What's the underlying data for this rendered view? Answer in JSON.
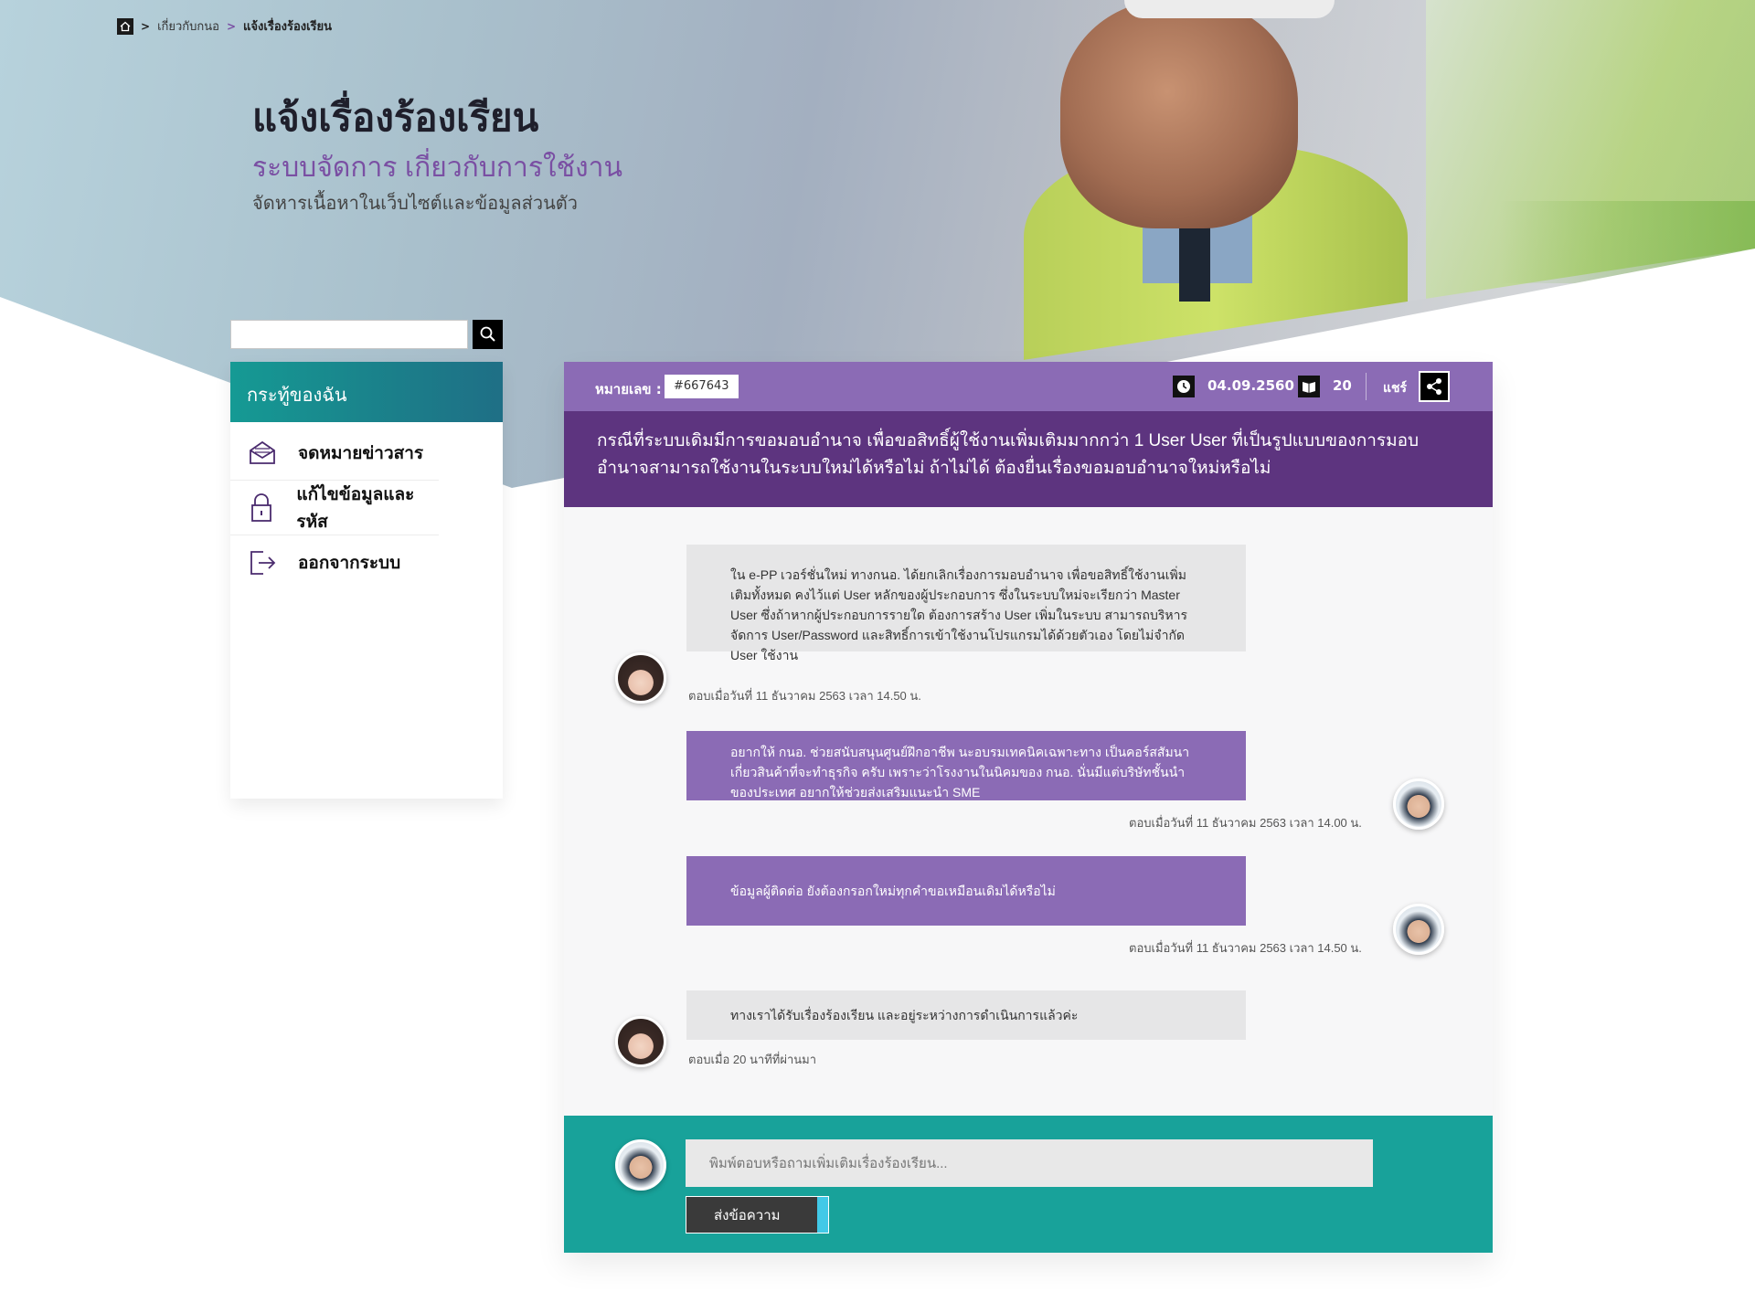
{
  "breadcrumb": {
    "items": [
      "เกี่ยวกับกนอ",
      "แจ้งเรื่องร้องเรียน"
    ]
  },
  "header": {
    "title": "แจ้งเรื่องร้องเรียน",
    "subtitle": "ระบบจัดการ เกี่ยวกับการใช้งาน",
    "description": "จัดหารเนื้อหาในเว็บไซต์และข้อมูลส่วนตัว"
  },
  "search": {
    "value": ""
  },
  "sidebar": {
    "title": "กระทู้ของฉัน",
    "items": [
      {
        "label": "จดหมายข่าวสาร",
        "icon": "mail-open-icon"
      },
      {
        "label": "แก้ไขข้อมูลและรหัส",
        "icon": "lock-icon"
      },
      {
        "label": "ออกจากระบบ",
        "icon": "logout-icon"
      }
    ]
  },
  "ticket": {
    "number_label": "หมายเลข :",
    "number": "#667643",
    "date": "04.09.2560",
    "reads": "20",
    "share_label": "แชร์",
    "question": "กรณีที่ระบบเดิมมีการขอมอบอำนาจ เพื่อขอสิทธิ์ผู้ใช้งานเพิ่มเติมมากกว่า 1 User User ที่เป็นรูปแบบของการมอบอำนาจสามารถใช้งานในระบบใหม่ได้หรือไม่ ถ้าไม่ได้ ต้องยื่นเรื่องขอมอบอำนาจใหม่หรือไม่"
  },
  "messages": [
    {
      "side": "left",
      "text": "ใน e-PP เวอร์ชั่นใหม่ ทางกนอ. ได้ยกเลิกเรื่องการมอบอำนาจ เพื่อขอสิทธิ์ใช้งานเพิ่มเติมทั้งหมด คงไว้แต่ User หลักของผู้ประกอบการ ซึ่งในระบบใหม่จะเรียกว่า Master User ซึ่งถ้าหากผู้ประกอบการรายใด ต้องการสร้าง User เพิ่มในระบบ สามารถบริหารจัดการ User/Password และสิทธิ์การเข้าใช้งานโปรแกรมได้ด้วยตัวเอง โดยไม่จำกัด User ใช้งาน",
      "time": "ตอบเมื่อวันที่ 11 ธันวาคม 2563  เวลา 14.50 น."
    },
    {
      "side": "right",
      "text": "อยากให้ กนอ. ช่วยสนับสนุนศูนย์ฝึกอาชีพ นะอบรมเทคนิคเฉพาะทาง เป็นคอร์สสัมนา เกี่ยวสินค้าที่จะทำธุรกิจ ครับ เพราะว่าโรงงานในนิคมของ กนอ. นั่นมีแต่บริษัทชั้นนำของประเทศ อยากให้ช่วยส่งเสริมแนะนำ SME",
      "time": "ตอบเมื่อวันที่ 11 ธันวาคม 2563  เวลา 14.00 น."
    },
    {
      "side": "right",
      "text": "ข้อมูลผู้ติดต่อ ยังต้องกรอกใหม่ทุกคำขอเหมือนเดิมได้หรือไม่",
      "time": "ตอบเมื่อวันที่ 11 ธันวาคม 2563  เวลา 14.50 น."
    },
    {
      "side": "left",
      "text": "ทางเราได้รับเรื่องร้องเรียน และอยู่ระหว่างการดำเนินการแล้วค่ะ",
      "time": "ตอบเมื่อ 20 นาทีที่ผ่านมา"
    }
  ],
  "reply": {
    "placeholder": "พิมพ์ตอบหรือถามเพิ่มเติมเรื่องร้องเรียน...",
    "send_label": "ส่งข้อความ"
  },
  "colors": {
    "purple": "#8b6bb5",
    "dark_purple": "#5d347f",
    "teal": "#18a29a",
    "accent_cyan": "#41c9e7"
  }
}
